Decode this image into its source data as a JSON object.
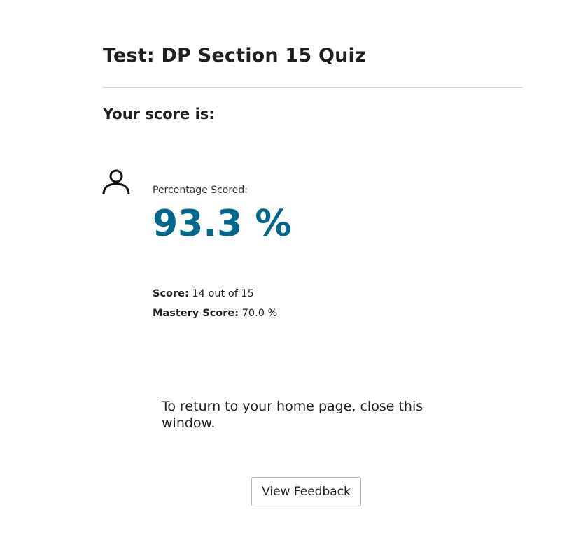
{
  "header": {
    "title": "Test: DP Section 15 Quiz"
  },
  "result": {
    "heading": "Your score is:",
    "percentage_label": "Percentage Scored:",
    "percentage_value": "93.3 %",
    "score_label": "Score:",
    "score_value": "14 out of 15",
    "mastery_label": "Mastery Score:",
    "mastery_value": "70.0 %"
  },
  "footer": {
    "return_message": "To return to your home page, close this window.",
    "feedback_button_label": "View Feedback"
  },
  "icons": {
    "user": "user-icon"
  },
  "colors": {
    "accent": "#00688b",
    "text": "#222222",
    "divider": "#d9d9d9"
  }
}
